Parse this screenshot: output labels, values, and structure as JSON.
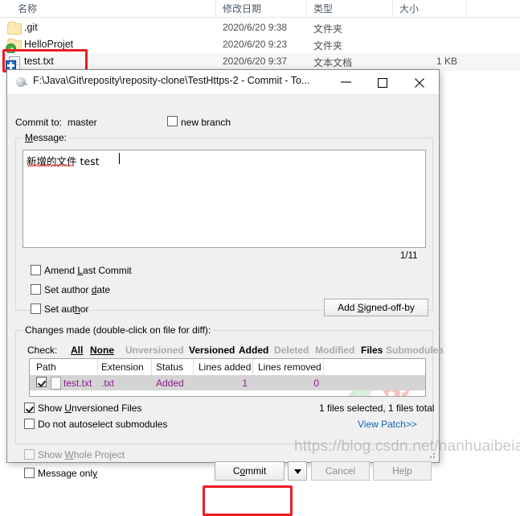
{
  "explorer": {
    "columns": [
      {
        "label": "名称"
      },
      {
        "label": "修改日期"
      },
      {
        "label": "类型"
      },
      {
        "label": "大小"
      }
    ],
    "rows": [
      {
        "name": ".git",
        "modified": "2020/6/20 9:38",
        "type": "文件夹",
        "size": "",
        "icon": "folder-icon"
      },
      {
        "name": "HelloProjet",
        "modified": "2020/6/20 9:23",
        "type": "文件夹",
        "size": "",
        "icon": "folder-modified-icon"
      },
      {
        "name": "test.txt",
        "modified": "2020/6/20 9:37",
        "type": "文本文档",
        "size": "1 KB",
        "icon": "text-file-added-icon"
      }
    ]
  },
  "dialog": {
    "title": "F:\\Java\\Git\\reposity\\reposity-clone\\TestHttps-2 - Commit - To...",
    "icon": "tortoisegit-icon",
    "window_buttons": {
      "minimize": "minimize-icon",
      "maximize": "maximize-icon",
      "close": "close-icon"
    },
    "commit_to_label": "Commit to:",
    "branch": "master",
    "new_branch_label": "new branch",
    "new_branch_checked": false,
    "message": {
      "caption": "Message:",
      "value": "新增的文件 test",
      "counter": "1/11"
    },
    "options": [
      {
        "label": "Amend Last Commit",
        "checked": false,
        "enabled": true
      },
      {
        "label": "Set author date",
        "checked": false,
        "enabled": true
      },
      {
        "label": "Set author",
        "checked": false,
        "enabled": true
      }
    ],
    "add_signed_off_by": "Add Signed-off-by",
    "changes": {
      "caption": "Changes made (double-click on file for diff):",
      "check_label": "Check:",
      "check_links": [
        {
          "label": "All",
          "enabled": true
        },
        {
          "label": "None",
          "enabled": true
        },
        {
          "label": "Unversioned",
          "enabled": false
        },
        {
          "label": "Versioned",
          "enabled": true
        },
        {
          "label": "Added",
          "enabled": true
        },
        {
          "label": "Deleted",
          "enabled": false
        },
        {
          "label": "Modified",
          "enabled": false
        },
        {
          "label": "Files",
          "enabled": true
        },
        {
          "label": "Submodules",
          "enabled": false
        }
      ],
      "table": {
        "headers": [
          "Path",
          "Extension",
          "Status",
          "Lines added",
          "Lines removed"
        ],
        "rows": [
          {
            "checked": true,
            "path": "test.txt",
            "extension": ".txt",
            "status": "Added",
            "lines_added": "1",
            "lines_removed": "0"
          }
        ]
      },
      "show_unversioned_label": "Show Unversioned Files",
      "show_unversioned_checked": true,
      "no_autoselect_label": "Do not autoselect submodules",
      "no_autoselect_checked": false,
      "selection_summary": "1 files selected, 1 files total",
      "view_patch_label": "View Patch>>"
    },
    "show_whole_project_label": "Show Whole Project",
    "show_whole_project_checked": false,
    "show_whole_project_enabled": false,
    "message_only_label": "Message only",
    "message_only_checked": false,
    "buttons": {
      "commit": "Commit",
      "commit_dropdown": "chevron-down-icon",
      "cancel": "Cancel",
      "help": "Help"
    }
  },
  "watermark": "https://blog.csdn.net/nanhuaibeian",
  "colors": {
    "annotation_red": "#ee1c22",
    "link_blue": "#1464b4",
    "row_text_purple": "#8d1a8d",
    "dialog_face": "#f0f0f0"
  }
}
